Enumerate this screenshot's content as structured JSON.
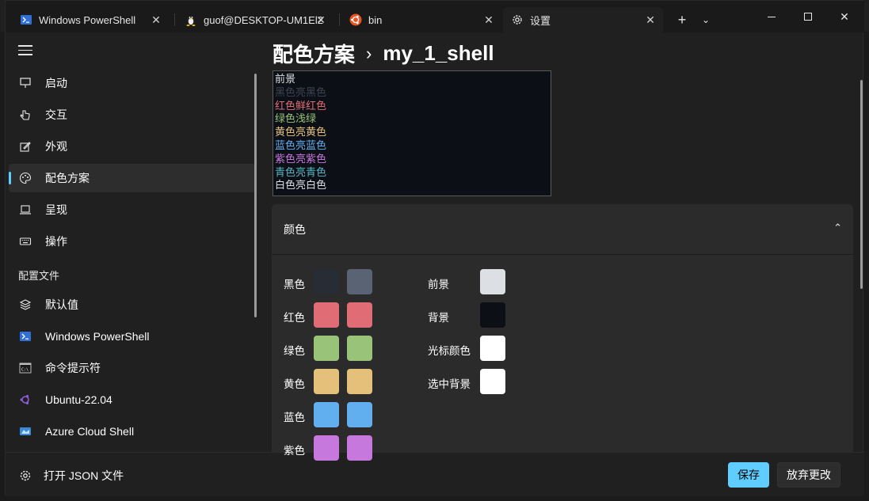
{
  "tabs": [
    {
      "label": "Windows PowerShell",
      "icon": "powershell-icon"
    },
    {
      "label": "guof@DESKTOP-UM1El2",
      "icon": "linux-tux-icon"
    },
    {
      "label": "bin",
      "icon": "ubuntu-icon"
    },
    {
      "label": "设置",
      "icon": "gear-icon",
      "active": true
    }
  ],
  "sidebar": {
    "items": [
      {
        "label": "启动",
        "icon": "startup-icon"
      },
      {
        "label": "交互",
        "icon": "interaction-icon"
      },
      {
        "label": "外观",
        "icon": "appearance-icon"
      },
      {
        "label": "配色方案",
        "icon": "palette-icon",
        "selected": true
      },
      {
        "label": "呈现",
        "icon": "rendering-icon"
      },
      {
        "label": "操作",
        "icon": "keyboard-icon"
      }
    ],
    "profiles_section": "配置文件",
    "profiles": [
      {
        "label": "默认值",
        "icon": "layers-icon"
      },
      {
        "label": "Windows PowerShell",
        "icon": "powershell-icon"
      },
      {
        "label": "命令提示符",
        "icon": "cmd-icon"
      },
      {
        "label": "Ubuntu-22.04",
        "icon": "ubuntu-icon"
      },
      {
        "label": "Azure Cloud Shell",
        "icon": "azure-icon"
      }
    ],
    "open_json": "打开 JSON 文件"
  },
  "breadcrumb": {
    "parent": "配色方案",
    "current": "my_1_shell"
  },
  "preview": {
    "lines": [
      {
        "text": "前景",
        "color": "#dcdfe4"
      },
      {
        "text": "黑色亮黑色",
        "color": "#3d4350"
      },
      {
        "text": "红色鲜红色",
        "color": "#e06c75"
      },
      {
        "text": "绿色浅绿",
        "color": "#98c379"
      },
      {
        "text": "黄色亮黄色",
        "color": "#e5c07b"
      },
      {
        "text": "蓝色亮蓝色",
        "color": "#61afef"
      },
      {
        "text": "紫色亮紫色",
        "color": "#c678dd"
      },
      {
        "text": "青色亮青色",
        "color": "#56b6c2"
      },
      {
        "text": "白色亮白色",
        "color": "#dcdfe4"
      }
    ]
  },
  "colors_section": {
    "title": "颜色",
    "palette": [
      {
        "label": "黑色",
        "normal": "#282c34",
        "bright": "#5a6374"
      },
      {
        "label": "红色",
        "normal": "#e06c75",
        "bright": "#e06c75"
      },
      {
        "label": "绿色",
        "normal": "#98c379",
        "bright": "#98c379"
      },
      {
        "label": "黄色",
        "normal": "#e5c07b",
        "bright": "#e5c07b"
      },
      {
        "label": "蓝色",
        "normal": "#61afef",
        "bright": "#61afef"
      },
      {
        "label": "紫色",
        "normal": "#c678dd",
        "bright": "#c678dd"
      }
    ],
    "system": [
      {
        "label": "前景",
        "color": "#dcdfe4"
      },
      {
        "label": "背景",
        "color": "#0c0f15"
      },
      {
        "label": "光标颜色",
        "color": "#ffffff"
      },
      {
        "label": "选中背景",
        "color": "#ffffff"
      }
    ]
  },
  "buttons": {
    "save": "保存",
    "discard": "放弃更改"
  },
  "accent": "#60cdff"
}
